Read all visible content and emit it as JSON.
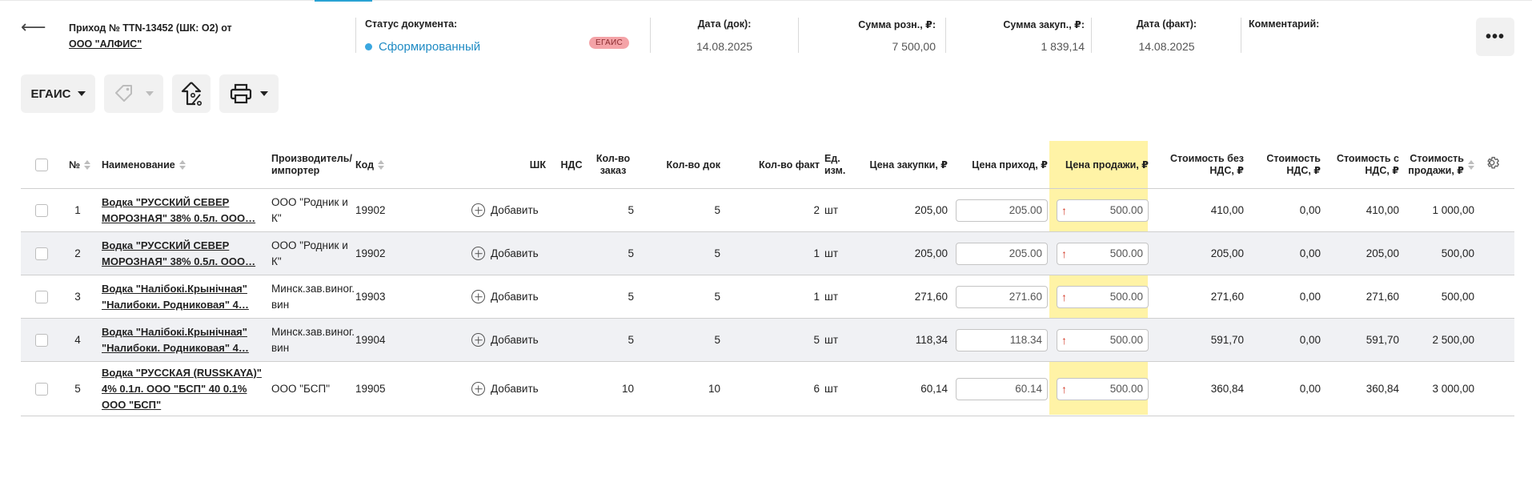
{
  "header": {
    "back_icon": "arrow-left-icon",
    "title_prefix": "Приход № TTN-13452 (ШК: O2) от",
    "supplier": "ООО \"АЛФИС\"",
    "status_label": "Статус документа:",
    "status_value": "Сформированный",
    "status_color": "#3aa7e0",
    "egais_badge": "ЕГАИС",
    "date_doc_label": "Дата (док):",
    "date_doc_value": "14.08.2025",
    "sum_retail_label": "Сумма розн., ₽:",
    "sum_retail_value": "7 500,00",
    "sum_purchase_label": "Сумма закуп., ₽:",
    "sum_purchase_value": "1 839,14",
    "date_fact_label": "Дата (факт):",
    "date_fact_value": "14.08.2025",
    "comment_label": "Комментарий:",
    "more_label": "•••"
  },
  "toolbar": {
    "egais_label": "ЕГАИС",
    "tag_icon": "tag-icon",
    "percent_icon": "price-up-percent-icon",
    "print_icon": "printer-icon"
  },
  "table": {
    "columns": {
      "num": "№",
      "name": "Наименование",
      "producer": "Производитель/импортер",
      "code": "Код",
      "barcode": "ШК",
      "vat": "НДС",
      "qty_order": "Кол-во заказ",
      "qty_doc": "Кол-во док",
      "qty_fact": "Кол-во факт",
      "unit": "Ед. изм.",
      "purchase_price": "Цена закупки, ₽",
      "income_price": "Цена приход, ₽",
      "sale_price": "Цена продажи, ₽",
      "cost_no_vat": "Стоимость без НДС, ₽",
      "vat_cost": "Стоимость НДС, ₽",
      "cost_with_vat": "Стоимость с НДС, ₽",
      "sale_cost": "Стоимость продажи, ₽"
    },
    "rows": [
      {
        "num": "1",
        "name": "Водка \"РУССКИЙ СЕВЕР МОРОЗНАЯ\" 38% 0.5л. ООО…",
        "producer": "ООО \"Родник и К\"",
        "code": "19902",
        "add": "Добавить",
        "qty_order": "5",
        "qty_doc": "5",
        "qty_fact": "2",
        "unit": "шт",
        "purchase_price": "205,00",
        "income_price": "205.00",
        "sale_price": "500.00",
        "cost_no_vat": "410,00",
        "vat_cost": "0,00",
        "cost_with_vat": "410,00",
        "sale_cost": "1 000,00"
      },
      {
        "num": "2",
        "name": "Водка \"РУССКИЙ СЕВЕР МОРОЗНАЯ\" 38% 0.5л. ООО…",
        "producer": "ООО \"Родник и К\"",
        "code": "19902",
        "add": "Добавить",
        "qty_order": "5",
        "qty_doc": "5",
        "qty_fact": "1",
        "unit": "шт",
        "purchase_price": "205,00",
        "income_price": "205.00",
        "sale_price": "500.00",
        "cost_no_vat": "205,00",
        "vat_cost": "0,00",
        "cost_with_vat": "205,00",
        "sale_cost": "500,00"
      },
      {
        "num": "3",
        "name": "Водка \"Налібокі.Крынічная\" \"Налибоки. Родниковая\" 4…",
        "producer": "Минск.зав.виног.вин",
        "code": "19903",
        "add": "Добавить",
        "qty_order": "5",
        "qty_doc": "5",
        "qty_fact": "1",
        "unit": "шт",
        "purchase_price": "271,60",
        "income_price": "271.60",
        "sale_price": "500.00",
        "cost_no_vat": "271,60",
        "vat_cost": "0,00",
        "cost_with_vat": "271,60",
        "sale_cost": "500,00"
      },
      {
        "num": "4",
        "name": "Водка \"Налібокі.Крынічная\" \"Налибоки. Родниковая\" 4…",
        "producer": "Минск.зав.виног.вин",
        "code": "19904",
        "add": "Добавить",
        "qty_order": "5",
        "qty_doc": "5",
        "qty_fact": "5",
        "unit": "шт",
        "purchase_price": "118,34",
        "income_price": "118.34",
        "sale_price": "500.00",
        "cost_no_vat": "591,70",
        "vat_cost": "0,00",
        "cost_with_vat": "591,70",
        "sale_cost": "2 500,00"
      },
      {
        "num": "5",
        "name": "Водка \"РУССКАЯ (RUSSKAYA)\" 4% 0.1л. ООО \"БСП\" 40 0.1% ООО \"БСП\"",
        "producer": "ООО \"БСП\"",
        "code": "19905",
        "add": "Добавить",
        "qty_order": "10",
        "qty_doc": "10",
        "qty_fact": "6",
        "unit": "шт",
        "purchase_price": "60,14",
        "income_price": "60.14",
        "sale_price": "500.00",
        "cost_no_vat": "360,84",
        "vat_cost": "0,00",
        "cost_with_vat": "360,84",
        "sale_cost": "3 000,00"
      }
    ]
  },
  "colors": {
    "accent": "#29a3d4",
    "sale_column_bg": "#fff3a6",
    "price_up_arrow": "#d43c2a",
    "badge_bg": "#f4a3a7"
  }
}
